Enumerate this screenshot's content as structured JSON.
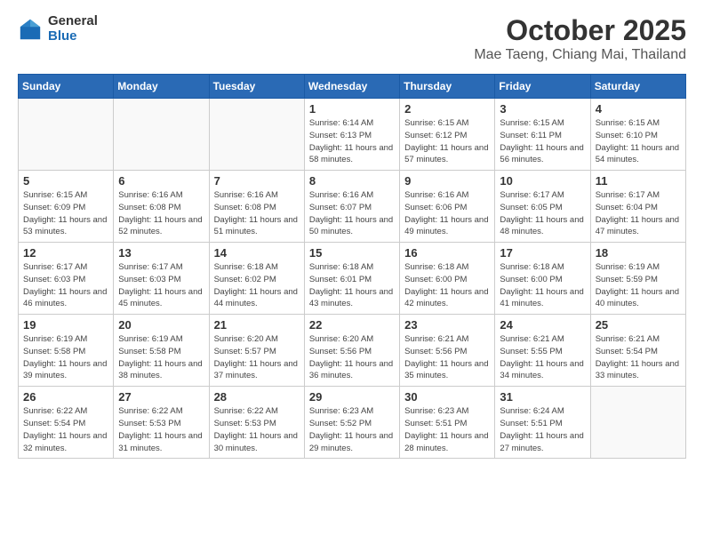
{
  "header": {
    "logo_general": "General",
    "logo_blue": "Blue",
    "month": "October 2025",
    "location": "Mae Taeng, Chiang Mai, Thailand"
  },
  "days_of_week": [
    "Sunday",
    "Monday",
    "Tuesday",
    "Wednesday",
    "Thursday",
    "Friday",
    "Saturday"
  ],
  "weeks": [
    [
      {
        "day": "",
        "sunrise": "",
        "sunset": "",
        "daylight": ""
      },
      {
        "day": "",
        "sunrise": "",
        "sunset": "",
        "daylight": ""
      },
      {
        "day": "",
        "sunrise": "",
        "sunset": "",
        "daylight": ""
      },
      {
        "day": "1",
        "sunrise": "Sunrise: 6:14 AM",
        "sunset": "Sunset: 6:13 PM",
        "daylight": "Daylight: 11 hours and 58 minutes."
      },
      {
        "day": "2",
        "sunrise": "Sunrise: 6:15 AM",
        "sunset": "Sunset: 6:12 PM",
        "daylight": "Daylight: 11 hours and 57 minutes."
      },
      {
        "day": "3",
        "sunrise": "Sunrise: 6:15 AM",
        "sunset": "Sunset: 6:11 PM",
        "daylight": "Daylight: 11 hours and 56 minutes."
      },
      {
        "day": "4",
        "sunrise": "Sunrise: 6:15 AM",
        "sunset": "Sunset: 6:10 PM",
        "daylight": "Daylight: 11 hours and 54 minutes."
      }
    ],
    [
      {
        "day": "5",
        "sunrise": "Sunrise: 6:15 AM",
        "sunset": "Sunset: 6:09 PM",
        "daylight": "Daylight: 11 hours and 53 minutes."
      },
      {
        "day": "6",
        "sunrise": "Sunrise: 6:16 AM",
        "sunset": "Sunset: 6:08 PM",
        "daylight": "Daylight: 11 hours and 52 minutes."
      },
      {
        "day": "7",
        "sunrise": "Sunrise: 6:16 AM",
        "sunset": "Sunset: 6:08 PM",
        "daylight": "Daylight: 11 hours and 51 minutes."
      },
      {
        "day": "8",
        "sunrise": "Sunrise: 6:16 AM",
        "sunset": "Sunset: 6:07 PM",
        "daylight": "Daylight: 11 hours and 50 minutes."
      },
      {
        "day": "9",
        "sunrise": "Sunrise: 6:16 AM",
        "sunset": "Sunset: 6:06 PM",
        "daylight": "Daylight: 11 hours and 49 minutes."
      },
      {
        "day": "10",
        "sunrise": "Sunrise: 6:17 AM",
        "sunset": "Sunset: 6:05 PM",
        "daylight": "Daylight: 11 hours and 48 minutes."
      },
      {
        "day": "11",
        "sunrise": "Sunrise: 6:17 AM",
        "sunset": "Sunset: 6:04 PM",
        "daylight": "Daylight: 11 hours and 47 minutes."
      }
    ],
    [
      {
        "day": "12",
        "sunrise": "Sunrise: 6:17 AM",
        "sunset": "Sunset: 6:03 PM",
        "daylight": "Daylight: 11 hours and 46 minutes."
      },
      {
        "day": "13",
        "sunrise": "Sunrise: 6:17 AM",
        "sunset": "Sunset: 6:03 PM",
        "daylight": "Daylight: 11 hours and 45 minutes."
      },
      {
        "day": "14",
        "sunrise": "Sunrise: 6:18 AM",
        "sunset": "Sunset: 6:02 PM",
        "daylight": "Daylight: 11 hours and 44 minutes."
      },
      {
        "day": "15",
        "sunrise": "Sunrise: 6:18 AM",
        "sunset": "Sunset: 6:01 PM",
        "daylight": "Daylight: 11 hours and 43 minutes."
      },
      {
        "day": "16",
        "sunrise": "Sunrise: 6:18 AM",
        "sunset": "Sunset: 6:00 PM",
        "daylight": "Daylight: 11 hours and 42 minutes."
      },
      {
        "day": "17",
        "sunrise": "Sunrise: 6:18 AM",
        "sunset": "Sunset: 6:00 PM",
        "daylight": "Daylight: 11 hours and 41 minutes."
      },
      {
        "day": "18",
        "sunrise": "Sunrise: 6:19 AM",
        "sunset": "Sunset: 5:59 PM",
        "daylight": "Daylight: 11 hours and 40 minutes."
      }
    ],
    [
      {
        "day": "19",
        "sunrise": "Sunrise: 6:19 AM",
        "sunset": "Sunset: 5:58 PM",
        "daylight": "Daylight: 11 hours and 39 minutes."
      },
      {
        "day": "20",
        "sunrise": "Sunrise: 6:19 AM",
        "sunset": "Sunset: 5:58 PM",
        "daylight": "Daylight: 11 hours and 38 minutes."
      },
      {
        "day": "21",
        "sunrise": "Sunrise: 6:20 AM",
        "sunset": "Sunset: 5:57 PM",
        "daylight": "Daylight: 11 hours and 37 minutes."
      },
      {
        "day": "22",
        "sunrise": "Sunrise: 6:20 AM",
        "sunset": "Sunset: 5:56 PM",
        "daylight": "Daylight: 11 hours and 36 minutes."
      },
      {
        "day": "23",
        "sunrise": "Sunrise: 6:21 AM",
        "sunset": "Sunset: 5:56 PM",
        "daylight": "Daylight: 11 hours and 35 minutes."
      },
      {
        "day": "24",
        "sunrise": "Sunrise: 6:21 AM",
        "sunset": "Sunset: 5:55 PM",
        "daylight": "Daylight: 11 hours and 34 minutes."
      },
      {
        "day": "25",
        "sunrise": "Sunrise: 6:21 AM",
        "sunset": "Sunset: 5:54 PM",
        "daylight": "Daylight: 11 hours and 33 minutes."
      }
    ],
    [
      {
        "day": "26",
        "sunrise": "Sunrise: 6:22 AM",
        "sunset": "Sunset: 5:54 PM",
        "daylight": "Daylight: 11 hours and 32 minutes."
      },
      {
        "day": "27",
        "sunrise": "Sunrise: 6:22 AM",
        "sunset": "Sunset: 5:53 PM",
        "daylight": "Daylight: 11 hours and 31 minutes."
      },
      {
        "day": "28",
        "sunrise": "Sunrise: 6:22 AM",
        "sunset": "Sunset: 5:53 PM",
        "daylight": "Daylight: 11 hours and 30 minutes."
      },
      {
        "day": "29",
        "sunrise": "Sunrise: 6:23 AM",
        "sunset": "Sunset: 5:52 PM",
        "daylight": "Daylight: 11 hours and 29 minutes."
      },
      {
        "day": "30",
        "sunrise": "Sunrise: 6:23 AM",
        "sunset": "Sunset: 5:51 PM",
        "daylight": "Daylight: 11 hours and 28 minutes."
      },
      {
        "day": "31",
        "sunrise": "Sunrise: 6:24 AM",
        "sunset": "Sunset: 5:51 PM",
        "daylight": "Daylight: 11 hours and 27 minutes."
      },
      {
        "day": "",
        "sunrise": "",
        "sunset": "",
        "daylight": ""
      }
    ]
  ]
}
